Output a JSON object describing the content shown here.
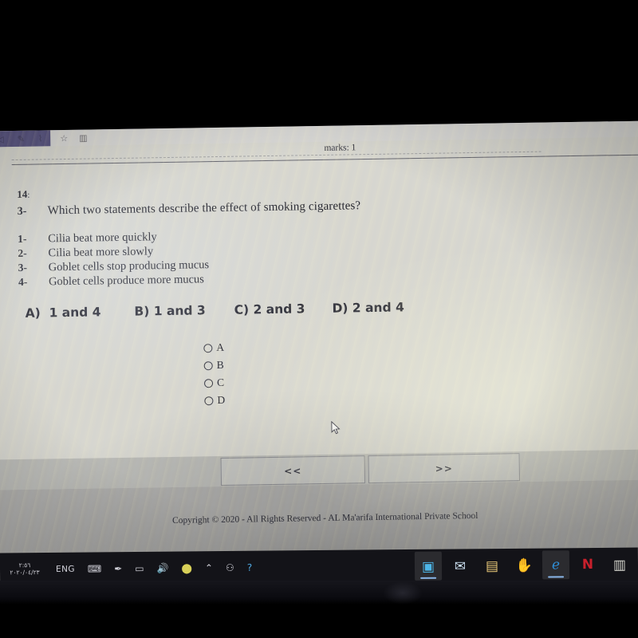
{
  "browser": {
    "toolbar_icons": [
      "back-arrow-icon",
      "pen-icon",
      "highlighter-icon",
      "favorites-star-icon",
      "reading-list-icon"
    ]
  },
  "exam": {
    "marks_label": "marks: 1",
    "question_number": "14",
    "question_number_colon": ":",
    "question_marker": "3-",
    "question_text": "Which two statements describe the effect of smoking cigarettes?",
    "statements": [
      {
        "marker": "1-",
        "text": "Cilia beat more quickly"
      },
      {
        "marker": "2-",
        "text": "Cilia beat more slowly"
      },
      {
        "marker": "3-",
        "text": "Goblet cells stop producing mucus"
      },
      {
        "marker": "4-",
        "text": "Goblet cells produce more mucus"
      }
    ],
    "choices": [
      {
        "label": "A)  1 and 4"
      },
      {
        "label": "B) 1 and 3"
      },
      {
        "label": "C) 2 and 3"
      },
      {
        "label": "D) 2 and 4"
      }
    ],
    "radio_options": [
      {
        "label": "A",
        "selected": false
      },
      {
        "label": "B",
        "selected": false
      },
      {
        "label": "C",
        "selected": false
      },
      {
        "label": "D",
        "selected": false
      }
    ],
    "nav": {
      "prev_label": "<<",
      "next_label": ">>"
    },
    "footer_text": "Copyright © 2020 - All Rights Reserved - AL Ma'arifa International Private School"
  },
  "taskbar": {
    "clock_time": "٢:٥٦",
    "clock_date": "٢٠٢٠/٠٤/٢٣",
    "language": "ENG",
    "tray_icons": [
      "keyboard-icon",
      "pen-icon",
      "touchpad-icon",
      "volume-icon",
      "update-icon",
      "show-hidden-icons-caret",
      "people-icon",
      "help-icon"
    ],
    "apps": [
      {
        "name": "camera-app",
        "glyph": "▣",
        "color": "#4db6e8",
        "active": true
      },
      {
        "name": "mail-app",
        "glyph": "✉",
        "color": "#cfe4f5",
        "active": false
      },
      {
        "name": "file-explorer-app",
        "glyph": "▤",
        "color": "#e8c878",
        "active": false
      },
      {
        "name": "sticky-notes-app",
        "glyph": "✋",
        "color": "#d8cf60",
        "active": false
      },
      {
        "name": "edge-browser-app",
        "glyph": "e",
        "color": "#2e8fd8",
        "active": true
      },
      {
        "name": "netflix-app",
        "glyph": "N",
        "color": "#c8202c",
        "active": false
      },
      {
        "name": "store-app",
        "glyph": "▥",
        "color": "#d8d8d0",
        "active": false
      }
    ]
  }
}
